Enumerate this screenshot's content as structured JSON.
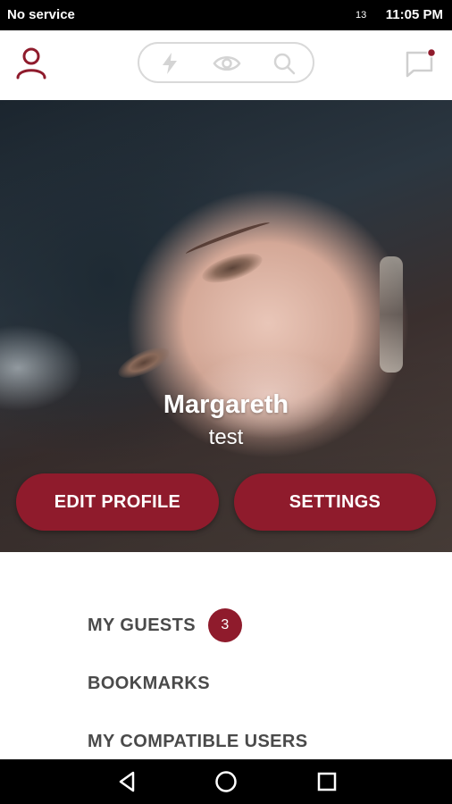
{
  "status_bar": {
    "carrier": "No service",
    "badge": "13",
    "time": "11:05 PM"
  },
  "app_bar": {
    "icons": [
      "person-icon",
      "flash-icon",
      "eye-icon",
      "search-icon",
      "chat-icon"
    ],
    "accent_color": "#8f1b2c"
  },
  "profile": {
    "name": "Margareth",
    "subtitle": "test",
    "edit_label": "EDIT PROFILE",
    "settings_label": "SETTINGS"
  },
  "menu": {
    "guests_label": "MY GUESTS",
    "guests_count": "3",
    "bookmarks_label": "BOOKMARKS",
    "compatible_label": "MY COMPATIBLE USERS"
  },
  "nav_bar": {
    "icons": [
      "back-icon",
      "home-icon",
      "recents-icon"
    ]
  }
}
